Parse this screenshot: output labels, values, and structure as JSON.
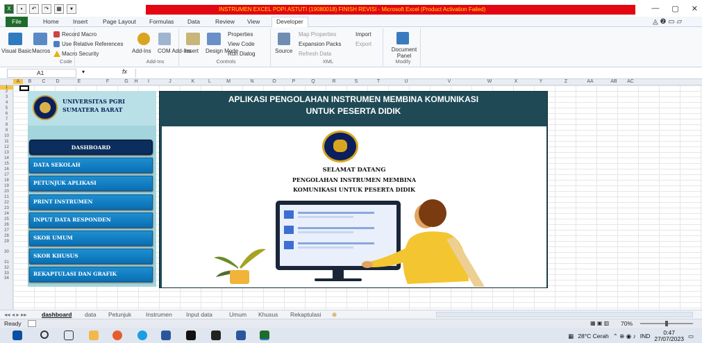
{
  "window": {
    "title": "INSTRUMEN EXCEL POPI ASTUTI (19080018) FINISH REVISI  -  Microsoft Excel (Product Activation Failed)",
    "controls": [
      "—",
      "▢",
      "✕"
    ]
  },
  "ribbon_tabs": [
    "File",
    "Home",
    "Insert",
    "Page Layout",
    "Formulas",
    "Data",
    "Review",
    "View",
    "Developer"
  ],
  "active_tab": "Developer",
  "ribbon": {
    "code": {
      "visual_basic": "Visual Basic",
      "macros": "Macros",
      "record_macro": "Record Macro",
      "relative_refs": "Use Relative References",
      "macro_security": "Macro Security",
      "label": "Code"
    },
    "addins": {
      "addins": "Add-Ins",
      "com": "COM Add-Ins",
      "label": "Add-Ins"
    },
    "controls": {
      "insert": "Insert",
      "design_mode": "Design Mode",
      "properties": "Properties",
      "view_code": "View Code",
      "run_dialog": "Run Dialog",
      "label": "Controls"
    },
    "xml": {
      "source": "Source",
      "map_properties": "Map Properties",
      "expansion_packs": "Expansion Packs",
      "refresh_data": "Refresh Data",
      "import": "Import",
      "export": "Export",
      "label": "XML"
    },
    "modify": {
      "document_panel": "Document Panel",
      "label": "Modify"
    }
  },
  "formula_bar": {
    "cell_ref": "A1",
    "fx": "fx",
    "value": ""
  },
  "columns": [
    "A",
    "B",
    "C",
    "D",
    "E",
    "F",
    "G",
    "H",
    "I",
    "J",
    "K",
    "L",
    "M",
    "N",
    "O",
    "P",
    "Q",
    "R",
    "S",
    "T",
    "U",
    "V",
    "W",
    "X",
    "Y",
    "Z",
    "AA",
    "AB",
    "AC"
  ],
  "rows": [
    "1",
    "2",
    "3",
    "4",
    "5",
    "6",
    "7",
    "8",
    "9",
    "10",
    "11",
    "12",
    "13",
    "14",
    "15",
    "16",
    "17",
    "18",
    "19",
    "20",
    "21",
    "22",
    "23",
    "24",
    "25",
    "26",
    "27",
    "28",
    "29",
    "30",
    "31",
    "32",
    "33",
    "34"
  ],
  "sidebar": {
    "university_line1": "UNIVERSITAS PGRI",
    "university_line2": "SUMATERA BARAT",
    "items": [
      "DASHBOARD",
      "DATA SEKOLAH",
      "PETUNJUK APLIKASI",
      "PRINT INSTRUMEN",
      "INPUT DATA RESPONDEN",
      "SKOR UMUM",
      "SKOR KHUSUS",
      "REKAPTULASI DAN GRAFIK"
    ]
  },
  "main": {
    "heading_line1": "APLIKASI PENGOLAHAN INSTRUMEN MEMBINA KOMUNIKASI",
    "heading_line2": "UNTUK PESERTA DIDIK",
    "welcome_line1": "SELAMAT DATANG",
    "welcome_line2": "PENGOLAHAN INSTRUMEN MEMBINA",
    "welcome_line3": "KOMUNIKASI UNTUK PESERTA DIDIK"
  },
  "sheet_tabs": [
    "dashboard",
    "data",
    "Petunjuk",
    "Instrumen",
    "Input data",
    "Umum",
    "Khusus",
    "Rekaptulasi"
  ],
  "active_sheet": "dashboard",
  "status": {
    "ready": "Ready",
    "zoom": "70%"
  },
  "taskbar": {
    "weather": "28°C Cerah",
    "lang": "IND",
    "time": "0:47",
    "date": "27/07/2023"
  },
  "colors": {
    "excel_green": "#1f6b2c",
    "title_red": "#e30613",
    "panel_teal": "#1f4a55",
    "nav_blue": "#0a6fb5",
    "sidebar_bg": "#a4d4dc",
    "dash_navy": "#0c2e5e"
  }
}
